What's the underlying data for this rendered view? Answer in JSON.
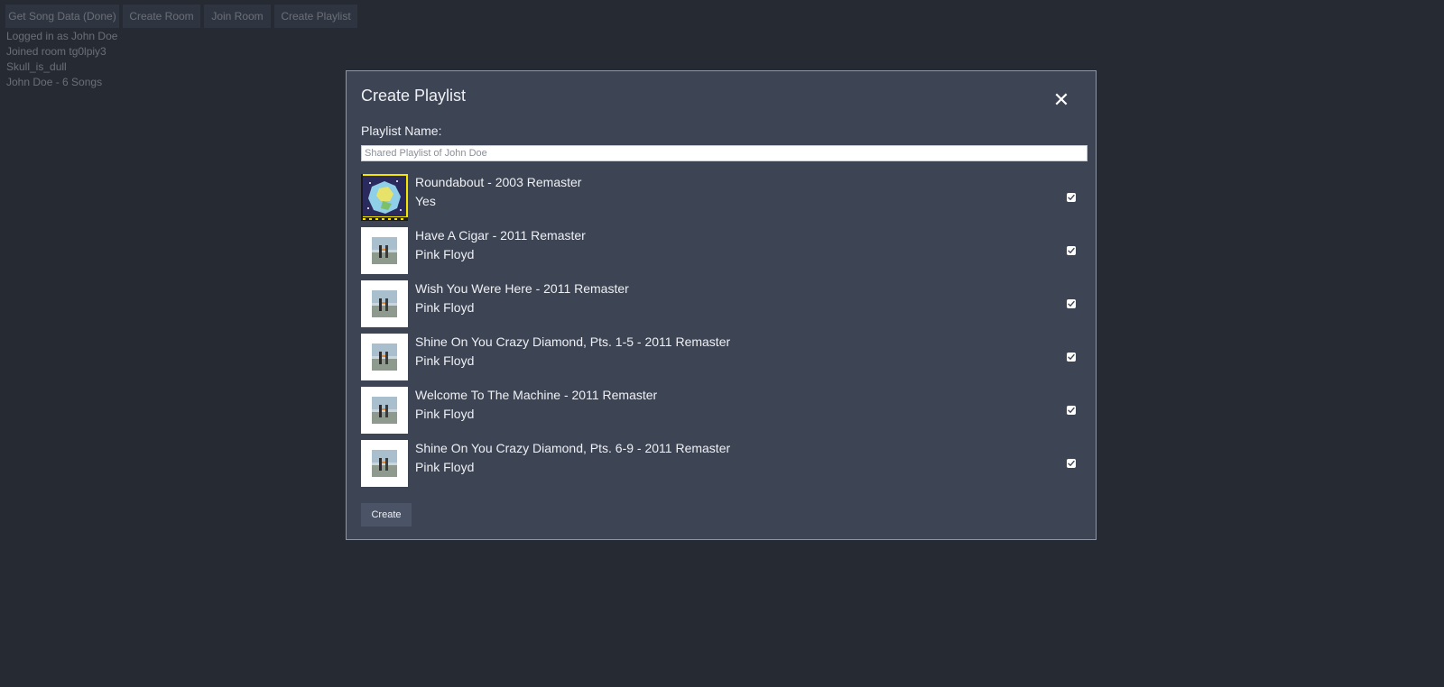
{
  "toolbar": {
    "buttons": [
      "Get Song Data (Done)",
      "Create Room",
      "Join Room",
      "Create Playlist"
    ]
  },
  "status": {
    "lines": [
      "Logged in as John Doe",
      "Joined room tg0lpiy3",
      "Skull_is_dull",
      "John Doe - 6 Songs"
    ]
  },
  "modal": {
    "title": "Create Playlist",
    "close_symbol": "✕",
    "name_label": "Playlist Name:",
    "name_placeholder": "Shared Playlist of John Doe",
    "create_label": "Create"
  },
  "songs": [
    {
      "title": "Roundabout - 2003 Remaster",
      "artist": "Yes",
      "checked": true,
      "cover_icon": "yes-album-cover"
    },
    {
      "title": "Have A Cigar - 2011 Remaster",
      "artist": "Pink Floyd",
      "checked": true,
      "cover_icon": "wish-you-were-here-cover"
    },
    {
      "title": "Wish You Were Here - 2011 Remaster",
      "artist": "Pink Floyd",
      "checked": true,
      "cover_icon": "wish-you-were-here-cover"
    },
    {
      "title": "Shine On You Crazy Diamond, Pts. 1-5 - 2011 Remaster",
      "artist": "Pink Floyd",
      "checked": true,
      "cover_icon": "wish-you-were-here-cover"
    },
    {
      "title": "Welcome To The Machine - 2011 Remaster",
      "artist": "Pink Floyd",
      "checked": true,
      "cover_icon": "wish-you-were-here-cover"
    },
    {
      "title": "Shine On You Crazy Diamond, Pts. 6-9 - 2011 Remaster",
      "artist": "Pink Floyd",
      "checked": true,
      "cover_icon": "wish-you-were-here-cover"
    }
  ],
  "colors": {
    "page_background": "#252a33",
    "modal_background": "#3d4454",
    "button_background": "#414a5b",
    "text": "#eef0f4"
  }
}
